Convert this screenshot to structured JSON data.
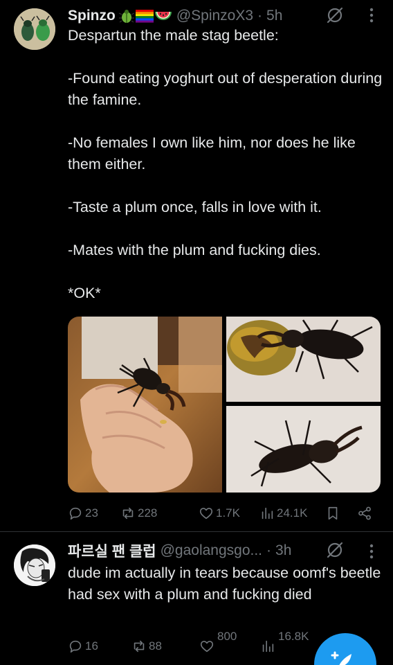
{
  "post1": {
    "display_name": "Spinzo",
    "handle": "@SpinzoX3",
    "separator": "·",
    "time": "5h",
    "text": "Despartun the male stag beetle:\n\n-Found eating yoghurt out of desperation during the famine.\n\n-No females I own like him, nor does he like them either.\n\n-Taste a plum once, falls in love with it.\n\n-Mates with the plum and fucking dies.\n\n*OK*",
    "badges": [
      "beetle-emoji",
      "rainbow-flag-emoji",
      "watermelon-emoji"
    ],
    "stats": {
      "replies": "23",
      "reposts": "228",
      "likes": "1.7K",
      "views": "24.1K"
    }
  },
  "post2": {
    "display_name": "파르실 팬 클럽",
    "handle": "@gaolangsgo...",
    "separator": "·",
    "time": "3h",
    "text": "dude im actually in tears because oomf's beetle had sex with a plum and fucking died",
    "stats": {
      "replies": "16",
      "reposts": "88",
      "likes": "800",
      "views": "16.8K"
    }
  },
  "colors": {
    "background": "#000000",
    "text": "#e7e9ea",
    "muted": "#71767b",
    "divider": "#2f3336",
    "accent": "#1d9bf0"
  }
}
